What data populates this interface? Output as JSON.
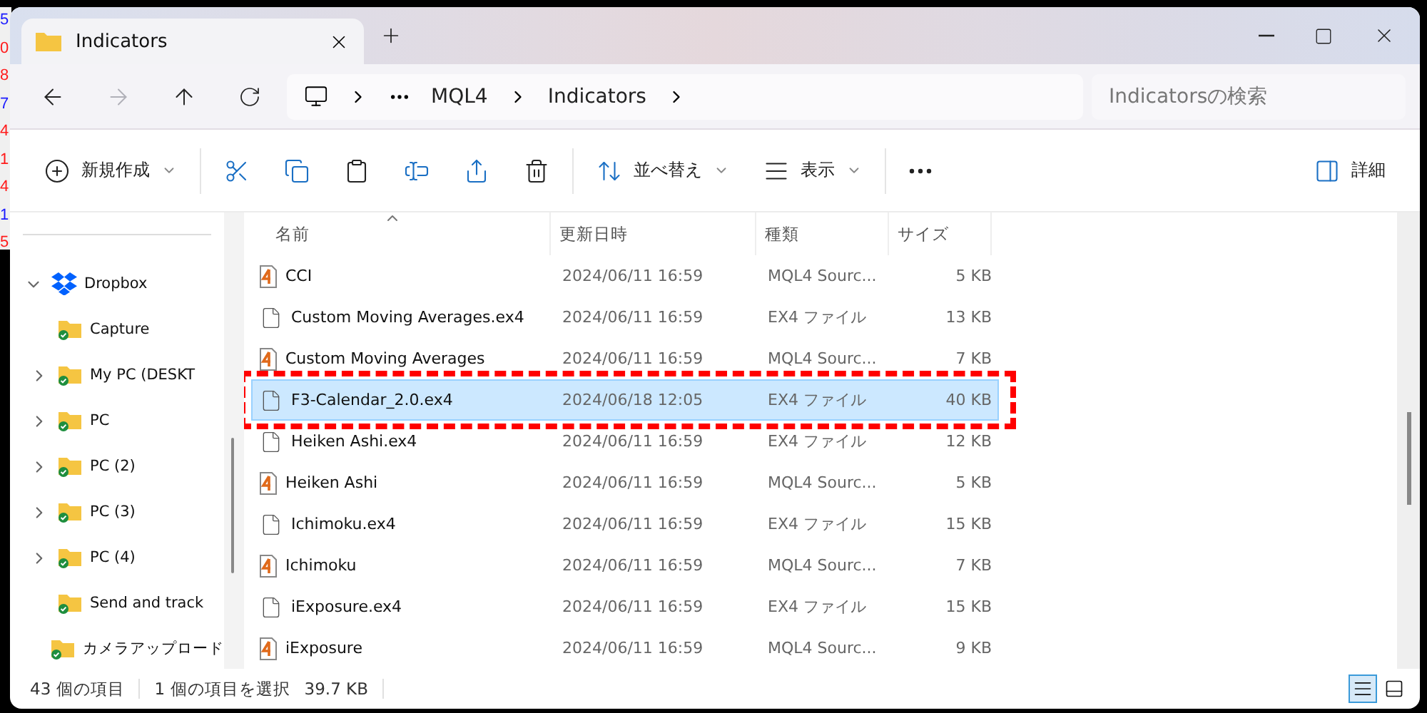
{
  "background": {
    "axis_labels": [
      {
        "text": "5",
        "color": "#1a1aff"
      },
      {
        "text": "0",
        "color": "#ff1a1a"
      },
      {
        "text": "8",
        "color": "#ff1a1a"
      },
      {
        "text": "7",
        "color": "#1a1aff"
      },
      {
        "text": "4",
        "color": "#ff1a1a"
      },
      {
        "text": "1",
        "color": "#ff1a1a"
      },
      {
        "text": "4",
        "color": "#ff1a1a"
      },
      {
        "text": "1",
        "color": "#1a1aff"
      },
      {
        "text": "5",
        "color": "#ff1a1a"
      }
    ]
  },
  "window": {
    "tab": {
      "title": "Indicators"
    }
  },
  "address": {
    "path": [
      "MQL4",
      "Indicators"
    ],
    "search": {
      "placeholder": "Indicatorsの検索"
    }
  },
  "commands": [
    {
      "kind": "new",
      "label": "新規作成"
    },
    {
      "kind": "cut"
    },
    {
      "kind": "copy"
    },
    {
      "kind": "paste"
    },
    {
      "kind": "rename"
    },
    {
      "kind": "share"
    },
    {
      "kind": "delete"
    },
    {
      "kind": "sort",
      "label": "並べ替え"
    },
    {
      "kind": "view",
      "label": "表示"
    },
    {
      "kind": "more"
    },
    {
      "kind": "details",
      "label": "詳細"
    }
  ],
  "sidebar": {
    "items": [
      {
        "label": "Dropbox",
        "expanded": true,
        "children": [
          {
            "label": "Capture",
            "expandable": false
          },
          {
            "label": "My PC (DESKT",
            "expandable": true
          },
          {
            "label": "PC",
            "expandable": true
          },
          {
            "label": "PC (2)",
            "expandable": true
          },
          {
            "label": "PC (3)",
            "expandable": true
          },
          {
            "label": "PC (4)",
            "expandable": true
          },
          {
            "label": "Send and track",
            "expandable": false
          },
          {
            "label": "カメラアップロード",
            "expandable": false
          }
        ]
      }
    ]
  },
  "table": {
    "columns": [
      {
        "label": "名前",
        "sorted": true
      },
      {
        "label": "更新日時",
        "sorted": false
      },
      {
        "label": "種類",
        "sorted": false
      },
      {
        "label": "サイズ",
        "sorted": false
      }
    ],
    "rows": [
      {
        "kind": "mql4",
        "name": "CCI",
        "modified": "2024/06/11 16:59",
        "type": "MQL4 Sourc...",
        "size": "5 KB",
        "selected": false,
        "highlighted": false
      },
      {
        "kind": "ex4",
        "name": "Custom Moving Averages.ex4",
        "modified": "2024/06/11 16:59",
        "type": "EX4 ファイル",
        "size": "13 KB",
        "selected": false,
        "highlighted": false
      },
      {
        "kind": "mql4",
        "name": "Custom Moving Averages",
        "modified": "2024/06/11 16:59",
        "type": "MQL4 Sourc...",
        "size": "7 KB",
        "selected": false,
        "highlighted": false
      },
      {
        "kind": "ex4",
        "name": "F3-Calendar_2.0.ex4",
        "modified": "2024/06/18 12:05",
        "type": "EX4 ファイル",
        "size": "40 KB",
        "selected": true,
        "highlighted": true
      },
      {
        "kind": "ex4",
        "name": "Heiken Ashi.ex4",
        "modified": "2024/06/11 16:59",
        "type": "EX4 ファイル",
        "size": "12 KB",
        "selected": false,
        "highlighted": false
      },
      {
        "kind": "mql4",
        "name": "Heiken Ashi",
        "modified": "2024/06/11 16:59",
        "type": "MQL4 Sourc...",
        "size": "5 KB",
        "selected": false,
        "highlighted": false
      },
      {
        "kind": "ex4",
        "name": "Ichimoku.ex4",
        "modified": "2024/06/11 16:59",
        "type": "EX4 ファイル",
        "size": "15 KB",
        "selected": false,
        "highlighted": false
      },
      {
        "kind": "mql4",
        "name": "Ichimoku",
        "modified": "2024/06/11 16:59",
        "type": "MQL4 Sourc...",
        "size": "7 KB",
        "selected": false,
        "highlighted": false
      },
      {
        "kind": "ex4",
        "name": "iExposure.ex4",
        "modified": "2024/06/11 16:59",
        "type": "EX4 ファイル",
        "size": "15 KB",
        "selected": false,
        "highlighted": false
      },
      {
        "kind": "mql4",
        "name": "iExposure",
        "modified": "2024/06/11 16:59",
        "type": "MQL4 Sourc...",
        "size": "9 KB",
        "selected": false,
        "highlighted": false
      }
    ]
  },
  "status_bar": {
    "item_count": "43 個の項目",
    "selection": "1 個の項目を選択",
    "selection_size": "39.7 KB",
    "view_modes": [
      {
        "kind": "details",
        "selected": true
      },
      {
        "kind": "tiles",
        "selected": false
      }
    ]
  }
}
